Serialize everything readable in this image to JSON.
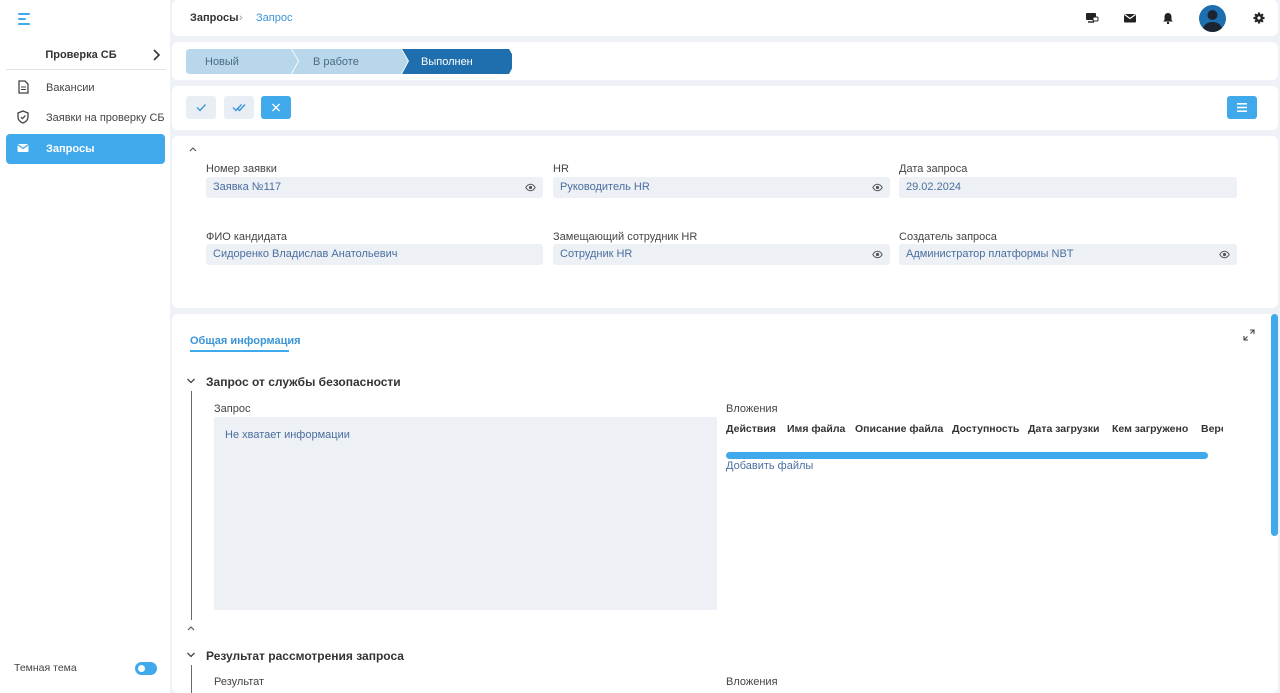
{
  "sidebar": {
    "header": "Проверка СБ",
    "items": [
      {
        "label": "Вакансии",
        "icon": "document-icon"
      },
      {
        "label": "Заявки на проверку СБ",
        "icon": "shield-check-icon"
      },
      {
        "label": "Запросы",
        "icon": "mail-icon",
        "active": true
      }
    ],
    "theme_label": "Темная тема",
    "theme_on": true
  },
  "header": {
    "breadcrumb": [
      "Запросы",
      "Запрос"
    ],
    "breadcrumb_sep": "›",
    "icons": [
      "monitor-chat-icon",
      "mail-icon",
      "bell-icon",
      "avatar",
      "gear-icon"
    ]
  },
  "status_steps": [
    {
      "label": "Новый",
      "state": "done"
    },
    {
      "label": "В работе",
      "state": "done"
    },
    {
      "label": "Выполнен",
      "state": "current"
    }
  ],
  "fields": {
    "request_number": {
      "label": "Номер заявки",
      "value": "Заявка №117"
    },
    "hr": {
      "label": "HR",
      "value": "Руководитель HR"
    },
    "request_date": {
      "label": "Дата запроса",
      "value": "29.02.2024"
    },
    "candidate": {
      "label": "ФИО кандидата",
      "value": "Сидоренко Владислав Анатольевич"
    },
    "deputy_hr": {
      "label": "Замещающий сотрудник HR",
      "value": "Сотрудник HR"
    },
    "creator": {
      "label": "Создатель запроса",
      "value": "Администратор платформы NBT"
    }
  },
  "details": {
    "tab": "Общая информация",
    "section1": {
      "title": "Запрос от службы безопасности",
      "request_label": "Запрос",
      "request_text": "Не хватает информации",
      "attachments_label": "Вложения",
      "columns": [
        "Действия",
        "Имя файла",
        "Описание файла",
        "Доступность",
        "Дата загрузки",
        "Кем загружено",
        "Версия"
      ],
      "add_files": "Добавить файлы"
    },
    "section2": {
      "title": "Результат рассмотрения запроса",
      "result_label": "Результат",
      "attachments_label": "Вложения"
    }
  },
  "colors": {
    "accent": "#3fa9eb",
    "step_done": "#b8d7ea",
    "step_current": "#1f6fae"
  }
}
